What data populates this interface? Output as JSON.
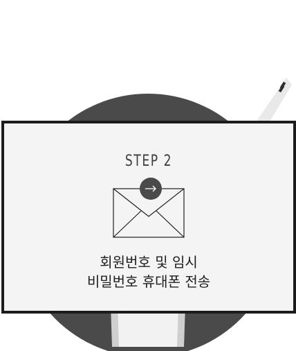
{
  "colors": {
    "card_border": "#1c1c1c",
    "card_background": "#f4f4f4",
    "circle": "#4a4a4a",
    "arrow_badge": "#4a4a4a",
    "text": "#1e1e1e"
  },
  "step": {
    "label": "STEP 2"
  },
  "icons": {
    "envelope": "envelope-icon",
    "arrow": "arrow-right-icon"
  },
  "description": {
    "line1": "회원번호 및 임시",
    "line2": "비밀번호 휴대폰 전송"
  }
}
